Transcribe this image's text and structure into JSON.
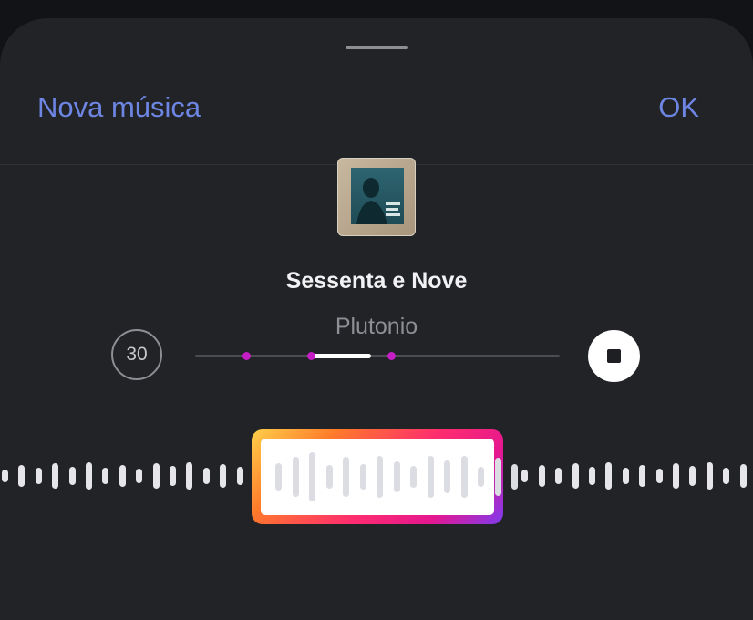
{
  "header": {
    "left_label": "Nova música",
    "right_label": "OK"
  },
  "track": {
    "title": "Sessenta e Nove",
    "artist": "Plutonio"
  },
  "controls": {
    "duration_label": "30",
    "stop_icon": "stop-icon"
  },
  "colors": {
    "accent": "#6d85e3",
    "sheet_bg": "#222326",
    "marker": "#c41ec4"
  }
}
